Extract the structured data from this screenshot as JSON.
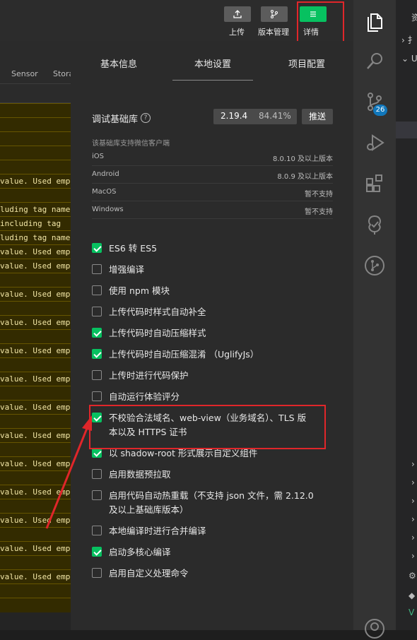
{
  "toolbar": {
    "upload_label": "上传",
    "version_label": "版本管理",
    "details_label": "详情"
  },
  "console": {
    "tabs": [
      "Sensor",
      "Stora"
    ],
    "lines": [
      "",
      "",
      "",
      "",
      "",
      "value. Used empt",
      "",
      "luding tag name",
      " including tag",
      "luding tag name",
      "value. Used empt",
      "value. Used empt",
      "",
      "value. Used empt",
      "",
      "value. Used empt",
      "",
      "value. Used empt",
      "",
      "value. Used empt",
      "",
      "value. Used empt",
      "",
      "value. Used empt",
      "",
      "value. Used empt",
      "",
      "value. Used empt",
      "",
      "value. Used empt",
      "",
      "value. Used empt",
      "",
      "value. Used empt",
      "",
      ""
    ]
  },
  "panel": {
    "tabs": [
      "基本信息",
      "本地设置",
      "项目配置"
    ],
    "active_tab": "本地设置",
    "base_lib_label": "调试基础库",
    "help_icon": "?",
    "version": "2.19.4",
    "version_percent": "84.41%",
    "push_label": "推送",
    "support_title": "该基础库支持微信客户端",
    "platforms": [
      {
        "name": "iOS",
        "value": "8.0.10 及以上版本"
      },
      {
        "name": "Android",
        "value": "8.0.9 及以上版本"
      },
      {
        "name": "MacOS",
        "value": "暂不支持"
      },
      {
        "name": "Windows",
        "value": "暂不支持"
      }
    ],
    "options": [
      {
        "label": "ES6 转 ES5",
        "checked": true
      },
      {
        "label": "增强编译",
        "checked": false
      },
      {
        "label": "使用 npm 模块",
        "checked": false
      },
      {
        "label": "上传代码时样式自动补全",
        "checked": false
      },
      {
        "label": "上传代码时自动压缩样式",
        "checked": true
      },
      {
        "label": "上传代码时自动压缩混淆 （UglifyJs）",
        "checked": true
      },
      {
        "label": "上传时进行代码保护",
        "checked": false
      },
      {
        "label": "自动运行体验评分",
        "checked": false
      },
      {
        "label": "不校验合法域名、web-view（业务域名）、TLS 版",
        "label2": "本以及 HTTPS 证书",
        "checked": true
      },
      {
        "label": "以 shadow-root 形式展示自定义组件",
        "checked": true
      },
      {
        "label": "启用数据预拉取",
        "checked": false
      },
      {
        "label": "启用代码自动热重载（不支持 json 文件，需 2.12.0",
        "label2": "及以上基础库版本）",
        "checked": false
      },
      {
        "label": "本地编译时进行合并编译",
        "checked": false
      },
      {
        "label": "启动多核心编译",
        "checked": true
      },
      {
        "label": "启用自定义处理命令",
        "checked": false
      }
    ]
  },
  "activity": {
    "scm_badge": "26"
  },
  "sidebar": {
    "item1": "资",
    "item2": "扌",
    "item3": "U"
  },
  "colors": {
    "accent": "#07c160",
    "annotation_red": "#e0262a",
    "badge_blue": "#1177bb"
  }
}
